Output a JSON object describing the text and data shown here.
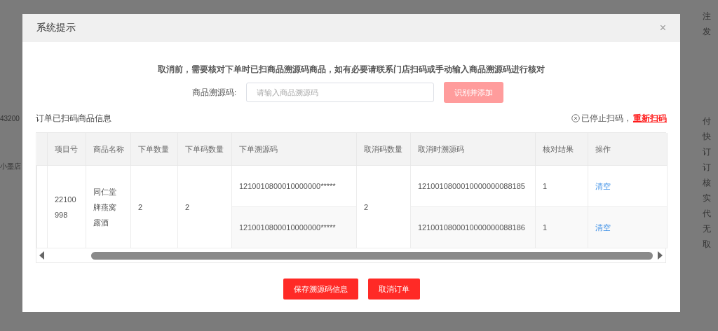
{
  "background": {
    "left_items": [
      "43200",
      "小墨店"
    ],
    "right_top": [
      "注",
      "发"
    ],
    "right_items": [
      "付",
      "快",
      "订",
      "订",
      "核",
      "实",
      "代",
      "无",
      "取"
    ]
  },
  "dialog": {
    "title": "系统提示",
    "close_label": "×",
    "notice": "取消前，需要核对下单时已扫商品溯源码商品，如有必要请联系门店扫码或手动输入商品溯源码进行核对",
    "code_field": {
      "label": "商品溯源码:",
      "placeholder": "请输入商品溯源码"
    },
    "add_button": {
      "label": "识别并添加",
      "disabled": true
    },
    "section_title": "订单已扫码商品信息",
    "scan_status": {
      "text": "已停止扫码，",
      "link": "重新扫码",
      "stopped": true
    },
    "table": {
      "columns": [
        "项目号",
        "商品名称",
        "下单数量",
        "下单码数量",
        "下单溯源码",
        "取消码数量",
        "取消时溯源码",
        "核对结果",
        "操作"
      ],
      "rows": [
        {
          "item_no": "22100998",
          "name": "同仁堂牌燕窝露酒",
          "order_qty": "2",
          "order_code_qty": "2",
          "cancel_code_qty": "2",
          "lines": [
            {
              "order_code": "1210010800010000000*****",
              "cancel_code": "1210010800010000000088185",
              "result": "1",
              "action": "清空"
            },
            {
              "order_code": "1210010800010000000*****",
              "cancel_code": "1210010800010000000088186",
              "result": "1",
              "action": "清空"
            }
          ]
        }
      ]
    },
    "buttons": [
      "保存溯源码信息",
      "取消订单"
    ]
  }
}
